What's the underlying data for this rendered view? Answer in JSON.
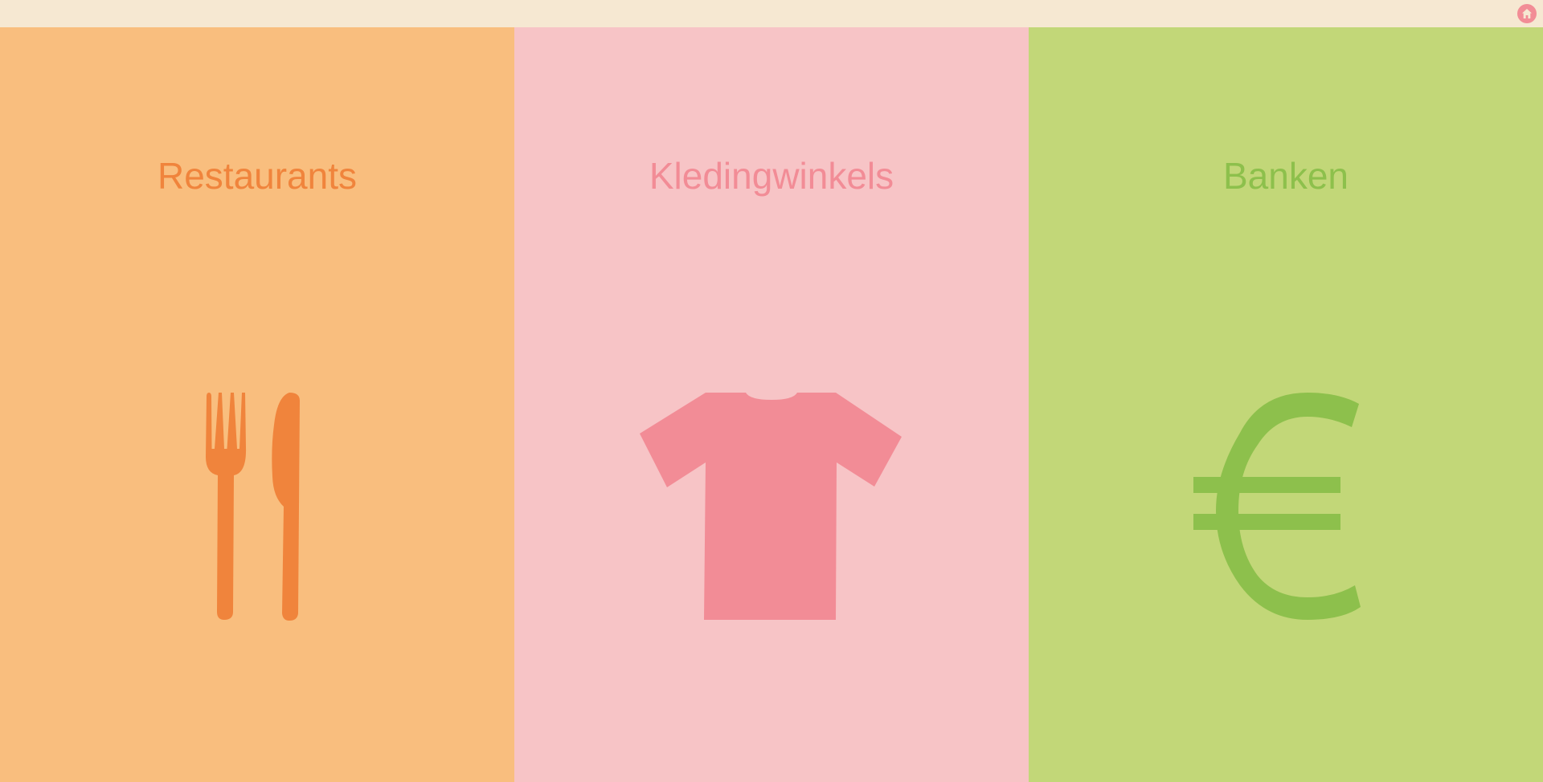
{
  "topbar": {
    "home_icon": "home-icon"
  },
  "panels": [
    {
      "title": "Restaurants",
      "icon": "fork-knife-icon",
      "background": "#f9be7e",
      "accent": "#f0843c"
    },
    {
      "title": "Kledingwinkels",
      "icon": "tshirt-icon",
      "background": "#f7c4c6",
      "accent": "#f28c96"
    },
    {
      "title": "Banken",
      "icon": "euro-icon",
      "background": "#c2d778",
      "accent": "#8dc04c"
    }
  ]
}
